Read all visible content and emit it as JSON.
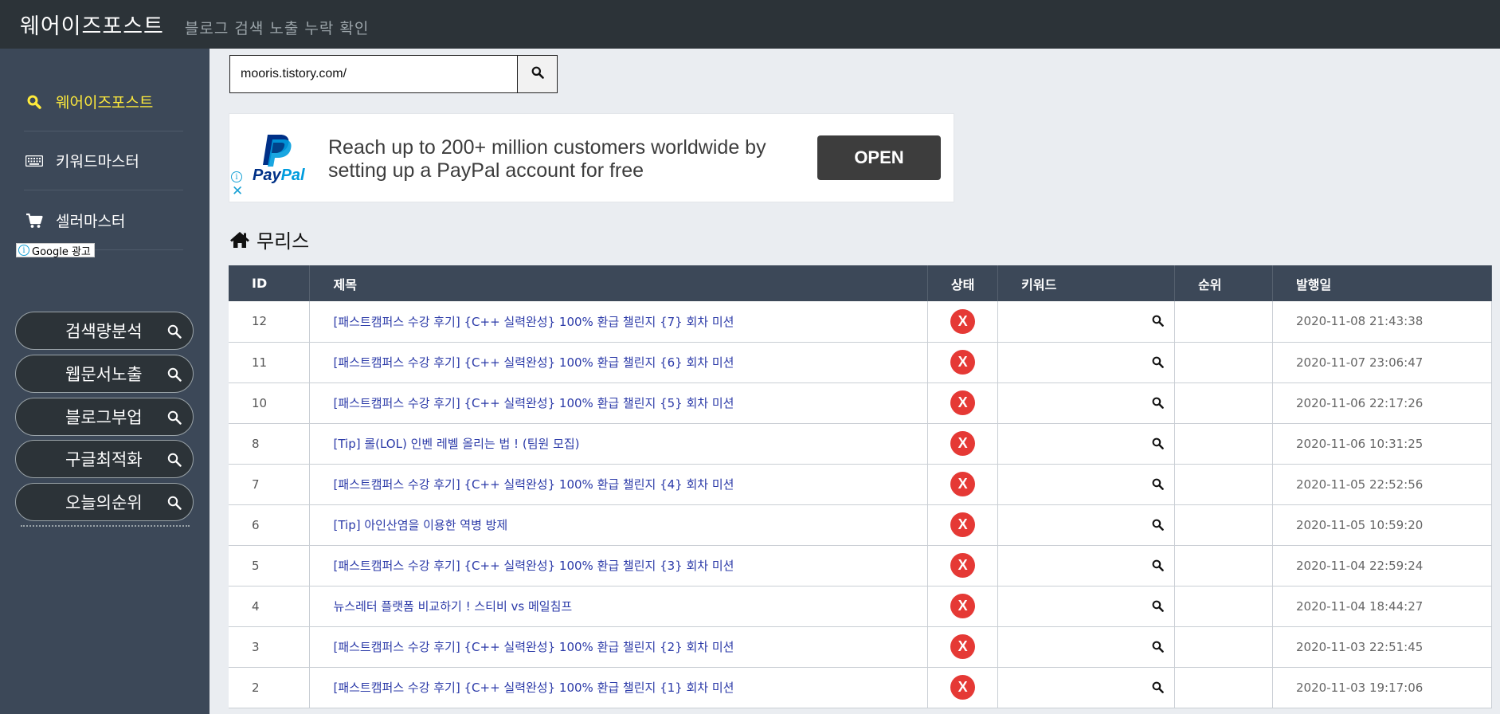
{
  "header": {
    "brand": "웨어이즈포스트",
    "tagline": "블로그 검색 노출 누락 확인"
  },
  "sidebar": {
    "items": [
      {
        "label": "웨어이즈포스트",
        "icon": "search-icon",
        "active": true
      },
      {
        "label": "키워드마스터",
        "icon": "keyboard-icon",
        "active": false
      },
      {
        "label": "셀러마스터",
        "icon": "cart-icon",
        "active": false
      }
    ],
    "ad_label": "Google 광고",
    "pills": [
      "검색량분석",
      "웹문서노출",
      "블로그부업",
      "구글최적화",
      "오늘의순위"
    ]
  },
  "search": {
    "value": "mooris.tistory.com/"
  },
  "ad": {
    "paypal_a": "Pay",
    "paypal_b": "Pal",
    "text": "Reach up to 200+ million customers worldwide by setting up a PayPal account for free",
    "button": "OPEN",
    "close": "✕"
  },
  "blog": {
    "name": "무리스"
  },
  "table": {
    "headers": {
      "id": "ID",
      "title": "제목",
      "state": "상태",
      "keyword": "키워드",
      "rank": "순위",
      "date": "발행일"
    },
    "rows": [
      {
        "id": "12",
        "title": "[패스트캠퍼스 수강 후기] {C++ 실력완성} 100% 환급 챌린지 {7} 회차 미션",
        "state": "X",
        "keyword": "",
        "rank": "",
        "date": "2020-11-08 21:43:38"
      },
      {
        "id": "11",
        "title": "[패스트캠퍼스 수강 후기] {C++ 실력완성} 100% 환급 챌린지 {6} 회차 미션",
        "state": "X",
        "keyword": "",
        "rank": "",
        "date": "2020-11-07 23:06:47"
      },
      {
        "id": "10",
        "title": "[패스트캠퍼스 수강 후기] {C++ 실력완성} 100% 환급 챌린지 {5} 회차 미션",
        "state": "X",
        "keyword": "",
        "rank": "",
        "date": "2020-11-06 22:17:26"
      },
      {
        "id": "8",
        "title": "[Tip] 롤(LOL) 인벤 레벨 올리는 법 ! (팀원 모집)",
        "state": "X",
        "keyword": "",
        "rank": "",
        "date": "2020-11-06 10:31:25"
      },
      {
        "id": "7",
        "title": "[패스트캠퍼스 수강 후기] {C++ 실력완성} 100% 환급 챌린지 {4} 회차 미션",
        "state": "X",
        "keyword": "",
        "rank": "",
        "date": "2020-11-05 22:52:56"
      },
      {
        "id": "6",
        "title": "[Tip] 아인산염을 이용한 역병 방제",
        "state": "X",
        "keyword": "",
        "rank": "",
        "date": "2020-11-05 10:59:20"
      },
      {
        "id": "5",
        "title": "[패스트캠퍼스 수강 후기] {C++ 실력완성} 100% 환급 챌린지 {3} 회차 미션",
        "state": "X",
        "keyword": "",
        "rank": "",
        "date": "2020-11-04 22:59:24"
      },
      {
        "id": "4",
        "title": "뉴스레터 플랫폼 비교하기 ! 스티비 vs 메일침프",
        "state": "X",
        "keyword": "",
        "rank": "",
        "date": "2020-11-04 18:44:27"
      },
      {
        "id": "3",
        "title": "[패스트캠퍼스 수강 후기] {C++ 실력완성} 100% 환급 챌린지 {2} 회차 미션",
        "state": "X",
        "keyword": "",
        "rank": "",
        "date": "2020-11-03 22:51:45"
      },
      {
        "id": "2",
        "title": "[패스트캠퍼스 수강 후기] {C++ 실력완성} 100% 환급 챌린지 {1} 회차 미션",
        "state": "X",
        "keyword": "",
        "rank": "",
        "date": "2020-11-03 19:17:06"
      }
    ]
  },
  "colors": {
    "header_bg": "#2c3338",
    "sidebar_bg": "#3c4858",
    "active": "#ffeb3b",
    "status_fail": "#e53935",
    "link": "#2b3aa8"
  }
}
